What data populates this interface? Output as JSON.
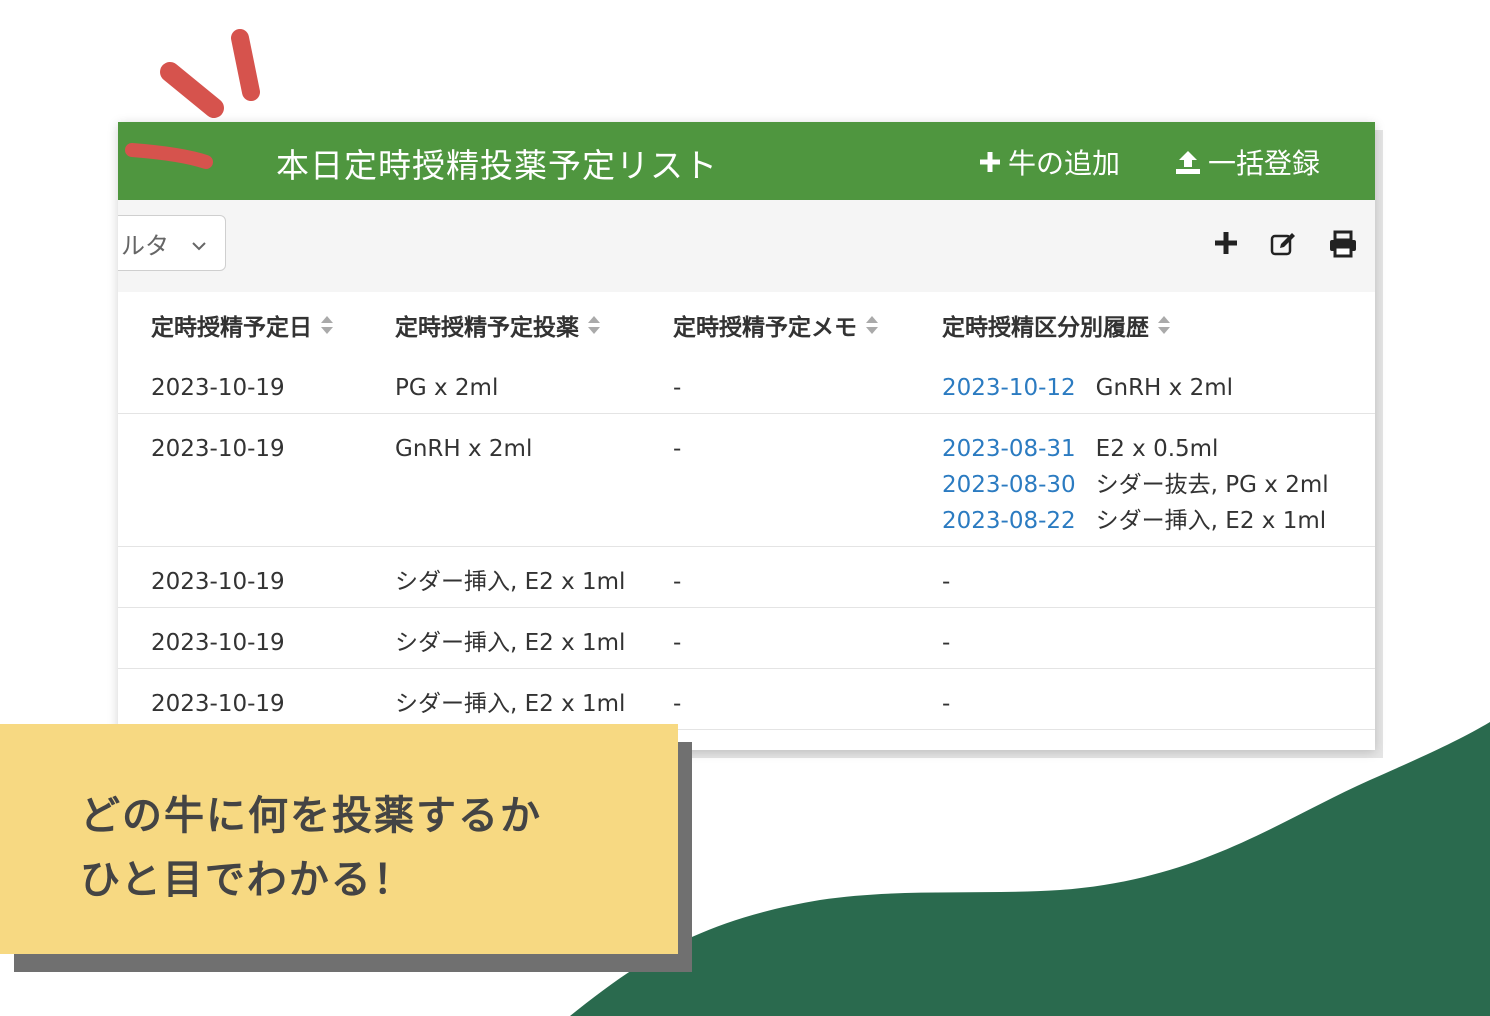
{
  "colors": {
    "header_bg": "#4f963f",
    "link": "#2b7bc1",
    "wave": "#2a6a4e",
    "accent_red": "#d6534d",
    "callout_bg": "#f7d982"
  },
  "header": {
    "title": "本日定時授精投薬予定リスト",
    "add_cow_label": "牛の追加",
    "bulk_register_label": "一括登録"
  },
  "toolbar": {
    "filter_label": "ルタ",
    "icons": [
      "plus-icon",
      "edit-icon",
      "print-icon"
    ]
  },
  "table": {
    "columns": [
      "定時授精予定日",
      "定時授精予定投薬",
      "定時授精予定メモ",
      "定時授精区分別履歴"
    ],
    "rows": [
      {
        "date": "2023-10-19",
        "medication": "PG x 2ml",
        "memo": "-",
        "history": [
          {
            "date": "2023-10-12",
            "text": "GnRH x 2ml"
          }
        ]
      },
      {
        "date": "2023-10-19",
        "medication": "GnRH x 2ml",
        "memo": "-",
        "history": [
          {
            "date": "2023-08-31",
            "text": "E2 x 0.5ml"
          },
          {
            "date": "2023-08-30",
            "text": "シダー抜去, PG x 2ml"
          },
          {
            "date": "2023-08-22",
            "text": "シダー挿入, E2 x 1ml"
          }
        ]
      },
      {
        "date": "2023-10-19",
        "medication": "シダー挿入, E2 x 1ml",
        "memo": "-",
        "history_empty": "-"
      },
      {
        "date": "2023-10-19",
        "medication": "シダー挿入, E2 x 1ml",
        "memo": "-",
        "history_empty": "-"
      },
      {
        "date": "2023-10-19",
        "medication": "シダー挿入, E2 x 1ml",
        "memo": "-",
        "history_empty": "-"
      }
    ]
  },
  "callout": {
    "line1": "どの牛に何を投薬するか",
    "line2": "ひと目でわかる！"
  }
}
